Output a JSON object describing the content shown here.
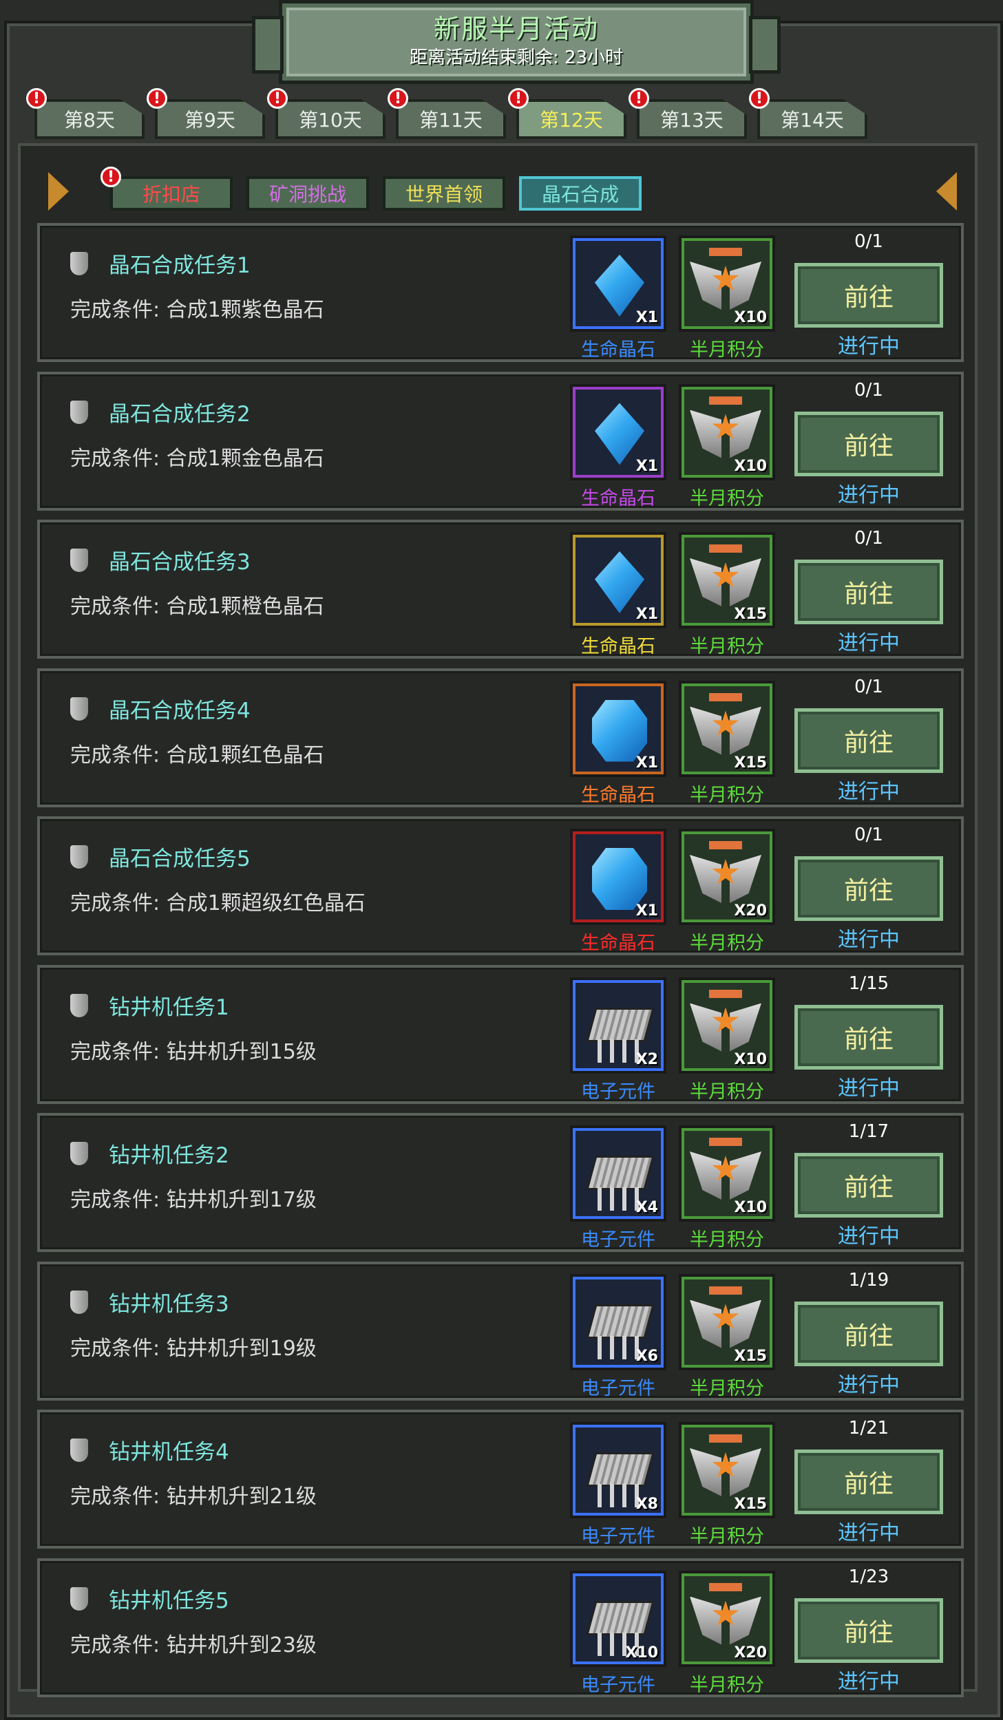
{
  "header": {
    "title": "新服半月活动",
    "subtitle": "距离活动结束剩余: 23小时"
  },
  "day_tabs": [
    {
      "label": "第8天",
      "alert": "!",
      "active": false
    },
    {
      "label": "第9天",
      "alert": "!",
      "active": false
    },
    {
      "label": "第10天",
      "alert": "!",
      "active": false
    },
    {
      "label": "第11天",
      "alert": "!",
      "active": false
    },
    {
      "label": "第12天",
      "alert": "!",
      "active": true
    },
    {
      "label": "第13天",
      "alert": "!",
      "active": false
    },
    {
      "label": "第14天",
      "alert": "!",
      "active": false
    }
  ],
  "sub_tabs": [
    {
      "label": "折扣店",
      "color": "#ff4a4a",
      "alert": "!",
      "active": false
    },
    {
      "label": "矿洞挑战",
      "color": "#d66ee8",
      "active": false
    },
    {
      "label": "世界首领",
      "color": "#f0e05a",
      "active": false
    },
    {
      "label": "晶石合成",
      "color": "#7ee6dd",
      "active": true
    }
  ],
  "go_label": "前往",
  "status_label": "进行中",
  "points_name": "半月积分",
  "tasks": [
    {
      "title": "晶石合成任务1",
      "condition": "完成条件: 合成1颗紫色晶石",
      "progress": "0/1",
      "item": {
        "name": "生命晶石",
        "qty": "X1",
        "type": "crystal",
        "rarity_color": "#3a72ff",
        "label_color": "#3a8bff"
      },
      "points_qty": "X10"
    },
    {
      "title": "晶石合成任务2",
      "condition": "完成条件: 合成1颗金色晶石",
      "progress": "0/1",
      "item": {
        "name": "生命晶石",
        "qty": "X1",
        "type": "crystal",
        "rarity_color": "#9b3fc7",
        "label_color": "#c44ae8"
      },
      "points_qty": "X10"
    },
    {
      "title": "晶石合成任务3",
      "condition": "完成条件: 合成1颗橙色晶石",
      "progress": "0/1",
      "item": {
        "name": "生命晶石",
        "qty": "X1",
        "type": "crystal",
        "rarity_color": "#b89a2c",
        "label_color": "#f0dc3a"
      },
      "points_qty": "X15"
    },
    {
      "title": "晶石合成任务4",
      "condition": "完成条件: 合成1颗红色晶石",
      "progress": "0/1",
      "item": {
        "name": "生命晶石",
        "qty": "X1",
        "type": "crystal-square",
        "rarity_color": "#c9661f",
        "label_color": "#ff7a2a"
      },
      "points_qty": "X15"
    },
    {
      "title": "晶石合成任务5",
      "condition": "完成条件: 合成1颗超级红色晶石",
      "progress": "0/1",
      "item": {
        "name": "生命晶石",
        "qty": "X1",
        "type": "crystal-square",
        "rarity_color": "#b51f1f",
        "label_color": "#ff2a2a"
      },
      "points_qty": "X20"
    },
    {
      "title": "钻井机任务1",
      "condition": "完成条件: 钻井机升到15级",
      "progress": "1/15",
      "item": {
        "name": "电子元件",
        "qty": "X2",
        "type": "chip",
        "rarity_color": "#3a72ff",
        "label_color": "#3a8bff"
      },
      "points_qty": "X10"
    },
    {
      "title": "钻井机任务2",
      "condition": "完成条件: 钻井机升到17级",
      "progress": "1/17",
      "item": {
        "name": "电子元件",
        "qty": "X4",
        "type": "chip",
        "rarity_color": "#3a72ff",
        "label_color": "#3a8bff"
      },
      "points_qty": "X10"
    },
    {
      "title": "钻井机任务3",
      "condition": "完成条件: 钻井机升到19级",
      "progress": "1/19",
      "item": {
        "name": "电子元件",
        "qty": "X6",
        "type": "chip",
        "rarity_color": "#3a72ff",
        "label_color": "#3a8bff"
      },
      "points_qty": "X15"
    },
    {
      "title": "钻井机任务4",
      "condition": "完成条件: 钻井机升到21级",
      "progress": "1/21",
      "item": {
        "name": "电子元件",
        "qty": "X8",
        "type": "chip",
        "rarity_color": "#3a72ff",
        "label_color": "#3a8bff"
      },
      "points_qty": "X15"
    },
    {
      "title": "钻井机任务5",
      "condition": "完成条件: 钻井机升到23级",
      "progress": "1/23",
      "item": {
        "name": "电子元件",
        "qty": "X10",
        "type": "chip",
        "rarity_color": "#3a72ff",
        "label_color": "#3a8bff"
      },
      "points_qty": "X20"
    }
  ],
  "colors": {
    "points_frame": "#4a9a3a",
    "points_label": "#5cdc3a",
    "status": "#5cc6ff"
  }
}
